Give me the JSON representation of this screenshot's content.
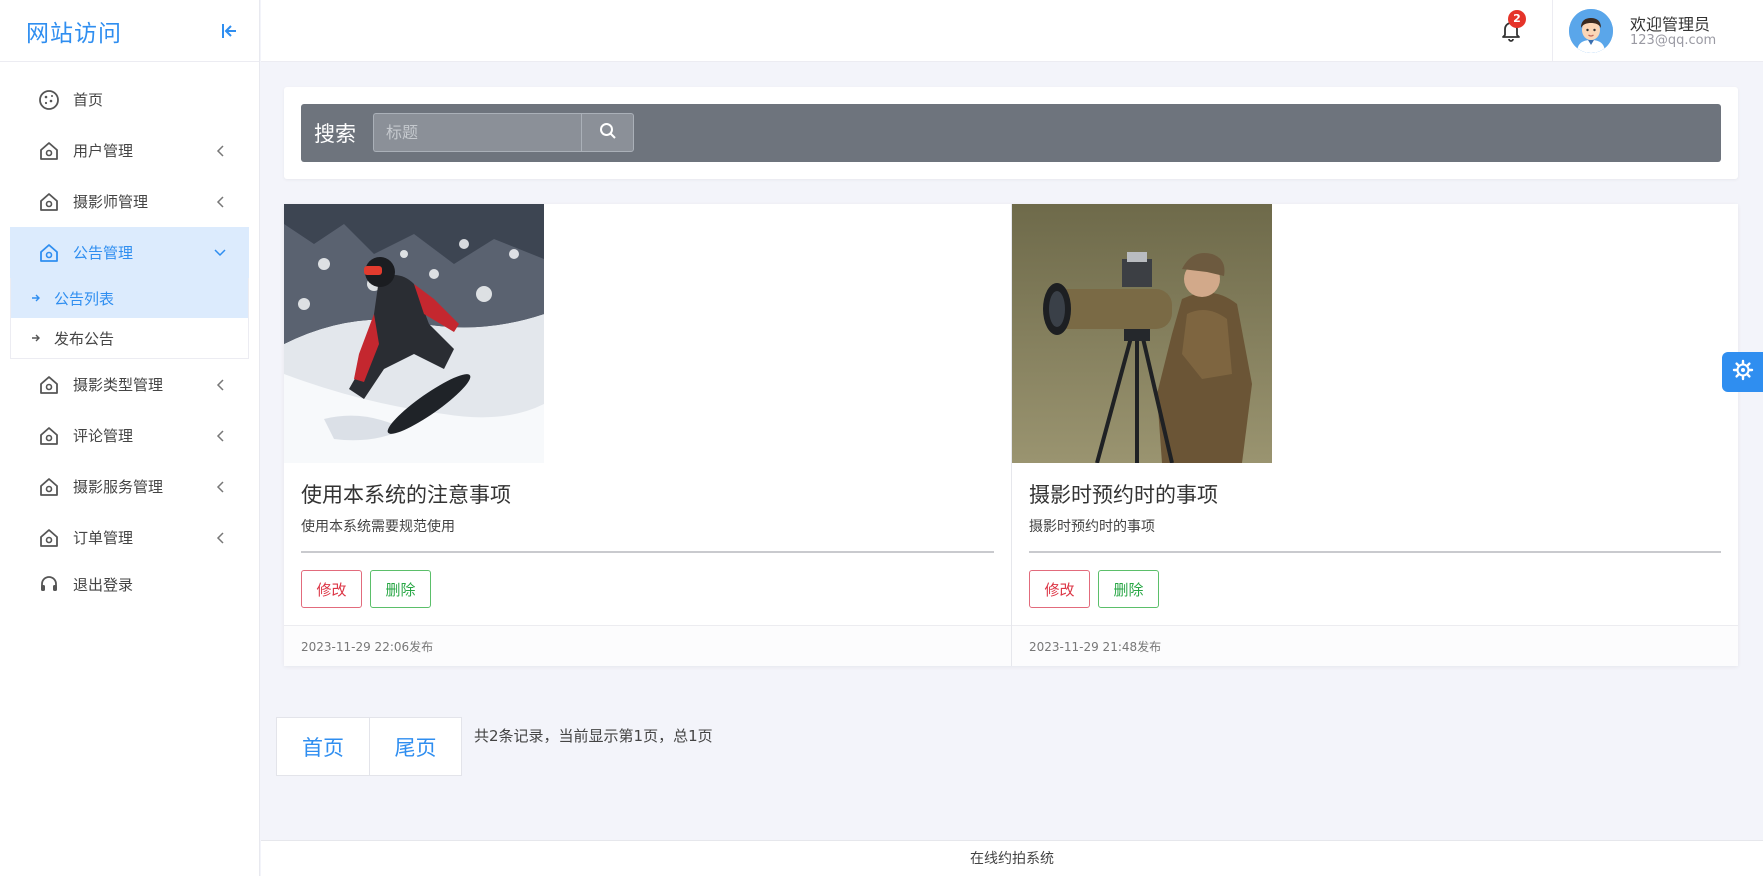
{
  "brand": {
    "title": "网站访问"
  },
  "sidebar": {
    "items": [
      {
        "label": "首页",
        "icon": "cookie-icon"
      },
      {
        "label": "用户管理",
        "icon": "home-icon"
      },
      {
        "label": "摄影师管理",
        "icon": "home-icon"
      },
      {
        "label": "公告管理",
        "icon": "home-icon",
        "active": true
      },
      {
        "label": "摄影类型管理",
        "icon": "home-icon"
      },
      {
        "label": "评论管理",
        "icon": "home-icon"
      },
      {
        "label": "摄影服务管理",
        "icon": "home-icon"
      },
      {
        "label": "订单管理",
        "icon": "home-icon"
      },
      {
        "label": "退出登录",
        "icon": "headset-icon"
      }
    ],
    "submenu": [
      {
        "label": "公告列表",
        "active": true
      },
      {
        "label": "发布公告"
      }
    ]
  },
  "topbar": {
    "notification_count": "2",
    "user_name": "欢迎管理员",
    "user_email": "123@qq.com"
  },
  "search": {
    "label": "搜索",
    "placeholder": "标题"
  },
  "cards": [
    {
      "title": "使用本系统的注意事项",
      "desc": "使用本系统需要规范使用",
      "edit_label": "修改",
      "delete_label": "删除",
      "date": "2023-11-29 22:06发布"
    },
    {
      "title": "摄影时预约时的事项",
      "desc": "摄影时预约时的事项",
      "edit_label": "修改",
      "delete_label": "删除",
      "date": "2023-11-29 21:48发布"
    }
  ],
  "pagination": {
    "first_label": "首页",
    "last_label": "尾页",
    "info": "共2条记录，当前显示第1页，总1页"
  },
  "footer": {
    "text": "在线约拍系统"
  },
  "colors": {
    "accent": "#2f8ef0",
    "danger": "#dc3545",
    "success": "#28a745",
    "search_bar": "#6e747d"
  }
}
